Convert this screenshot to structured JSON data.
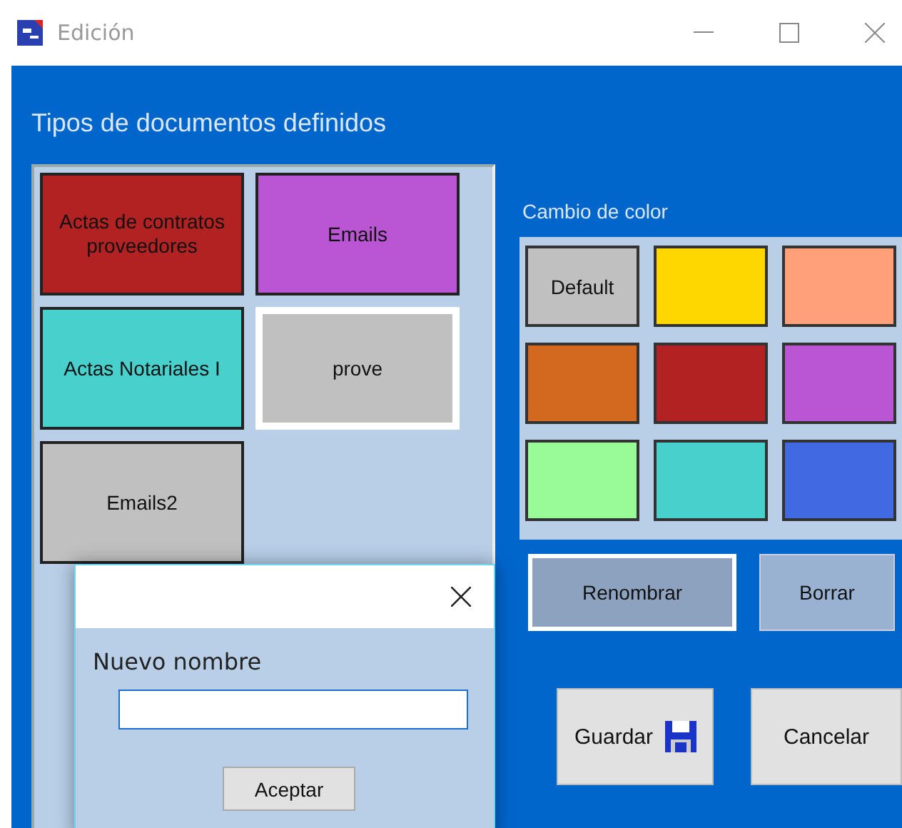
{
  "window": {
    "title": "Edición"
  },
  "document_types": {
    "title": "Tipos de documentos definidos",
    "items": [
      {
        "label": "Actas de contratos proveedores",
        "color": "#b22222",
        "selected": false
      },
      {
        "label": "Emails",
        "color": "#ba55d3",
        "selected": false
      },
      {
        "label": "Actas Notariales I",
        "color": "#48d1cc",
        "selected": false
      },
      {
        "label": "prove",
        "color": "#c0c0c0",
        "selected": true
      },
      {
        "label": "Emails2",
        "color": "#c0c0c0",
        "selected": false
      }
    ]
  },
  "color_change": {
    "title": "Cambio de color",
    "swatches": [
      {
        "kind": "default",
        "label": "Default",
        "color": "#c0c0c0"
      },
      {
        "kind": "color",
        "color": "#ffd700"
      },
      {
        "kind": "color",
        "color": "#ffa07a"
      },
      {
        "kind": "color",
        "color": "#d2691e"
      },
      {
        "kind": "color",
        "color": "#b22222"
      },
      {
        "kind": "color",
        "color": "#ba55d3"
      },
      {
        "kind": "color",
        "color": "#98fb98"
      },
      {
        "kind": "color",
        "color": "#48d1cc"
      },
      {
        "kind": "color",
        "color": "#4169e1"
      }
    ]
  },
  "actions": [
    {
      "label": "Renombrar",
      "selected": true
    },
    {
      "label": "Borrar",
      "selected": false
    }
  ],
  "footer_buttons": [
    {
      "label": "Guardar",
      "kind": "save"
    },
    {
      "label": "Cancelar",
      "kind": "plain"
    }
  ],
  "rename_dialog": {
    "label": "Nuevo nombre",
    "button": "Aceptar"
  }
}
